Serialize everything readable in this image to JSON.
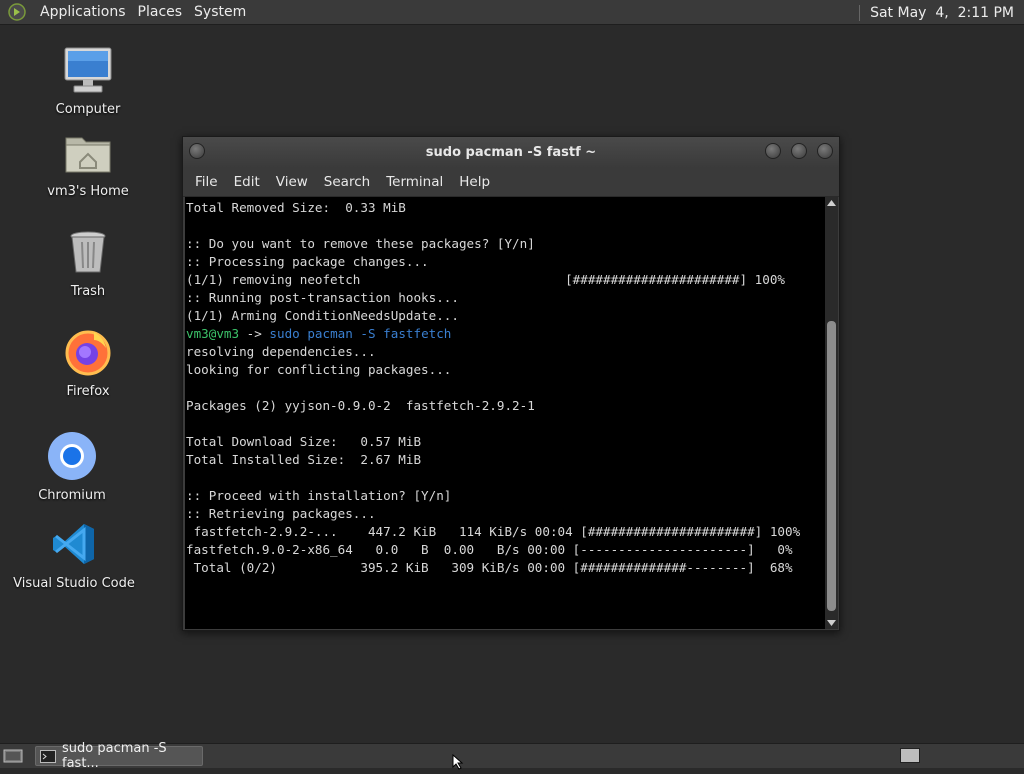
{
  "top_panel": {
    "menus": [
      "Applications",
      "Places",
      "System"
    ],
    "clock": "Sat May  4,  2:11 PM"
  },
  "desktop_icons": [
    {
      "label": "Computer",
      "icon": "computer-icon"
    },
    {
      "label": "vm3's Home",
      "icon": "home-folder-icon"
    },
    {
      "label": "Trash",
      "icon": "trash-icon"
    },
    {
      "label": "Firefox",
      "icon": "firefox-icon"
    },
    {
      "label": "Chromium",
      "icon": "chromium-icon"
    },
    {
      "label": "Visual Studio Code",
      "icon": "vscode-icon"
    }
  ],
  "terminal": {
    "title": "sudo pacman -S fastf ~",
    "menu": [
      "File",
      "Edit",
      "View",
      "Search",
      "Terminal",
      "Help"
    ],
    "lines": [
      "Total Removed Size:  0.33 MiB",
      "",
      ":: Do you want to remove these packages? [Y/n]",
      ":: Processing package changes...",
      "(1/1) removing neofetch                           [######################] 100%",
      ":: Running post-transaction hooks...",
      "(1/1) Arming ConditionNeedsUpdate...",
      "",
      "resolving dependencies...",
      "looking for conflicting packages...",
      "",
      "Packages (2) yyjson-0.9.0-2  fastfetch-2.9.2-1",
      "",
      "Total Download Size:   0.57 MiB",
      "Total Installed Size:  2.67 MiB",
      "",
      ":: Proceed with installation? [Y/n]",
      ":: Retrieving packages...",
      " fastfetch-2.9.2-...    447.2 KiB   114 KiB/s 00:04 [######################] 100%",
      "fastfetch.9.0-2-x86_64   0.0   B  0.00   B/s 00:00 [----------------------]   0%",
      " Total (0/2)           395.2 KiB   309 KiB/s 00:00 [##############--------]  68%"
    ],
    "prompt_user": "vm3@vm3",
    "prompt_arrow": " -> ",
    "prompt_command": "sudo pacman -S fastfetch"
  },
  "taskbar": {
    "window_button": "sudo pacman -S fast..."
  },
  "colors": {
    "desktop_bg": "#2a2a2a",
    "panel_bg": "#3a3a3a",
    "prompt_green": "#3cc36a",
    "command_blue": "#3a7fd0"
  }
}
